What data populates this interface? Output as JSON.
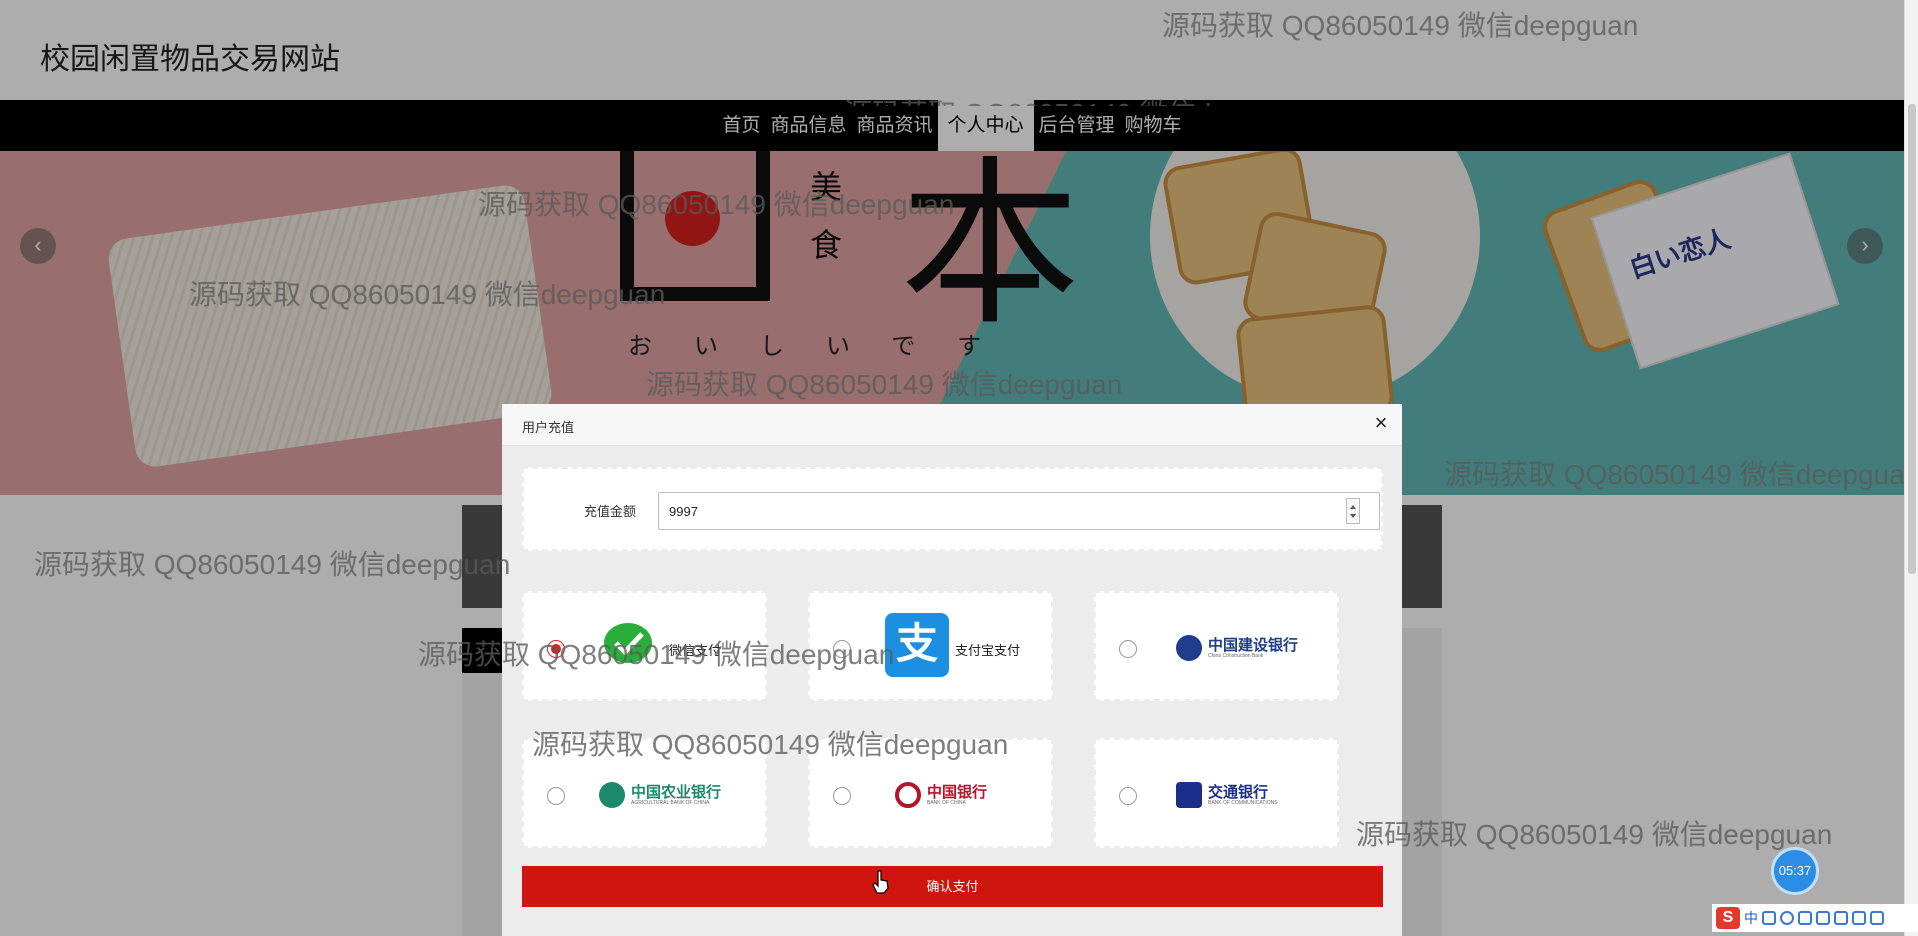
{
  "site": {
    "title": "校园闲置物品交易网站"
  },
  "nav": {
    "items": [
      "首页",
      "商品信息",
      "商品资讯",
      "个人中心",
      "后台管理",
      "购物车"
    ],
    "active": "个人中心"
  },
  "banner": {
    "main_kanji": "本",
    "small_kanji": "美食",
    "hiragana": "おいしいです",
    "package_label": "白い恋人",
    "prev_icon": "chevron-left-icon",
    "next_icon": "chevron-right-icon"
  },
  "modal": {
    "title": "用户充值",
    "close_glyph": "×",
    "amount_label": "充值金额",
    "amount_value": "9997",
    "payment_options": [
      {
        "name": "微信支付",
        "selected": true
      },
      {
        "name": "支付宝支付",
        "selected": false
      },
      {
        "name": "中国建设银行",
        "subtitle": "China Construction Bank",
        "selected": false
      },
      {
        "name": "中国农业银行",
        "subtitle": "AGRICULTURAL BANK OF CHINA",
        "selected": false
      },
      {
        "name": "中国银行",
        "subtitle": "BANK OF CHINA",
        "selected": false
      },
      {
        "name": "交通银行",
        "subtitle": "BANK OF COMMUNICATIONS",
        "selected": false
      }
    ],
    "confirm_label": "确认支付"
  },
  "watermark": "源码获取 QQ86050149 微信deepguan",
  "timer": "05:37",
  "ime": {
    "logo": "S",
    "mode": "中"
  },
  "colors": {
    "nav_bg": "#000000",
    "confirm_bg": "#d0140f",
    "radio_checked": "#d9231f",
    "wechat_green": "#2aae3a",
    "alipay_blue": "#1d8fe0",
    "ccb_blue": "#1f3d8a",
    "abc_green": "#1a8a6a",
    "boc_red": "#b3152a",
    "bocom_blue": "#1b2f8a"
  }
}
